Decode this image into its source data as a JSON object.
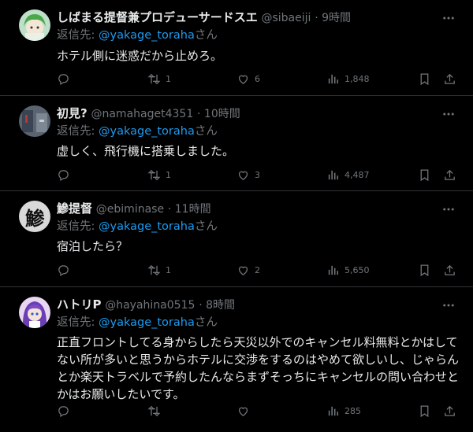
{
  "reply_prefix": "返信先:",
  "reply_suffix": "さん",
  "colors": {
    "background": "#000000",
    "text": "#e7e9ea",
    "muted": "#71767b",
    "link": "#1d9bf0",
    "divider": "#2f3336"
  },
  "icons": [
    "reply-icon",
    "retweet-icon",
    "like-icon",
    "views-icon",
    "bookmark-icon",
    "share-icon",
    "more-icon"
  ],
  "tweets": [
    {
      "name": "しばまる提督兼プロデューサードスエ",
      "handle": "@sibaeiji",
      "time": "· 9時間",
      "reply_to": "@yakage_toraha",
      "text": "ホテル側に迷惑だから止めろ。",
      "replies": "",
      "retweets": "1",
      "likes": "6",
      "views": "1,848"
    },
    {
      "name": "初見?",
      "handle": "@namahaget4351",
      "time": "· 10時間",
      "reply_to": "@yakage_toraha",
      "text": "虚しく、飛行機に搭乗しました。",
      "replies": "",
      "retweets": "1",
      "likes": "3",
      "views": "4,487"
    },
    {
      "name": "鰺提督",
      "handle": "@ebiminase",
      "time": "· 11時間",
      "reply_to": "@yakage_toraha",
      "text": "宿泊したら？",
      "avatar_glyph": "鯵",
      "replies": "",
      "retweets": "1",
      "likes": "2",
      "views": "5,650"
    },
    {
      "name": "ハトリP",
      "handle": "@hayahina0515",
      "time": "· 8時間",
      "reply_to": "@yakage_toraha",
      "text": "正直フロントしてる身からしたら天災以外でのキャンセル料無料とかはしてない所が多いと思うからホテルに交渉をするのはやめて欲しいし、じゃらんとか楽天トラベルで予約したんならまずそっちにキャンセルの問い合わせとかはお願いしたいです。",
      "replies": "",
      "retweets": "",
      "likes": "",
      "views": "285"
    }
  ]
}
